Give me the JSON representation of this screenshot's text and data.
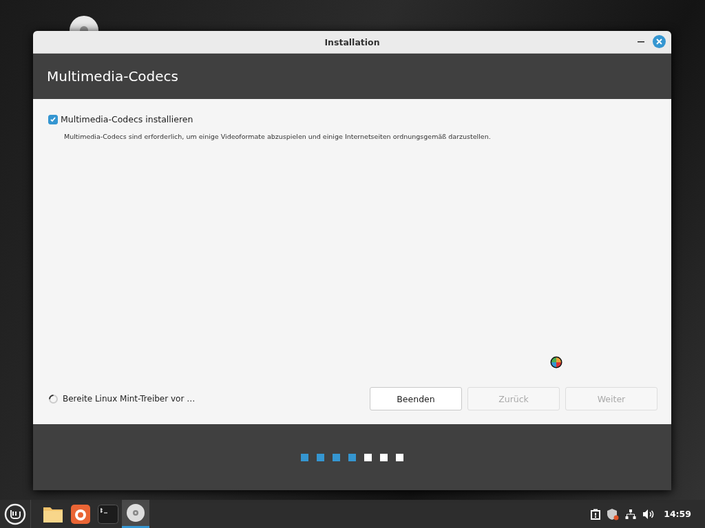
{
  "window": {
    "title": "Installation"
  },
  "header": {
    "title": "Multimedia-Codecs"
  },
  "option": {
    "label": "Multimedia-Codecs installieren",
    "checked": true,
    "description": "Multimedia-Codecs sind erforderlich, um einige Videoformate abzuspielen und einige Internetseiten ordnungsgemäß darzustellen."
  },
  "status": {
    "text": "Bereite Linux Mint-Treiber vor …"
  },
  "buttons": [
    {
      "label": "Beenden",
      "disabled": false
    },
    {
      "label": "Zurück",
      "disabled": true
    },
    {
      "label": "Weiter",
      "disabled": true
    }
  ],
  "steps": [
    {
      "done": true
    },
    {
      "done": true
    },
    {
      "done": true
    },
    {
      "done": true
    },
    {
      "done": false
    },
    {
      "done": false
    },
    {
      "done": false
    }
  ],
  "taskbar": {
    "apps": [
      {
        "kind": "folder",
        "active": false
      },
      {
        "kind": "browser",
        "active": false
      },
      {
        "kind": "terminal",
        "active": false
      },
      {
        "kind": "disc",
        "active": true
      }
    ],
    "clock": "14:59"
  }
}
